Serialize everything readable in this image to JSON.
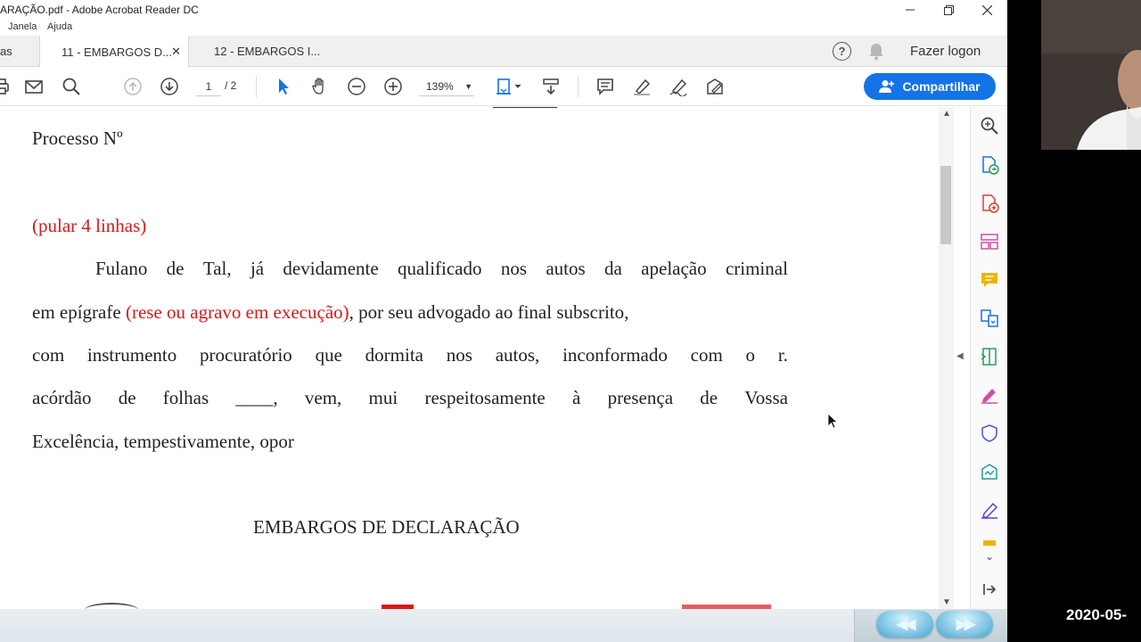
{
  "window": {
    "title": "ARAÇÃO.pdf - Adobe Acrobat Reader DC"
  },
  "menu": {
    "items": [
      "Janela",
      "Ajuda"
    ]
  },
  "tabs": {
    "home_partial": "as",
    "items": [
      {
        "label": "11 - EMBARGOS D...",
        "active": true
      },
      {
        "label": "12 - EMBARGOS I...",
        "active": false
      }
    ],
    "login_label": "Fazer logon"
  },
  "toolbar": {
    "page_current": "1",
    "page_total": "/ 2",
    "zoom": "139%",
    "share_label": "Compartilhar"
  },
  "document": {
    "line_processo": "Processo Nº",
    "line_pular": "(pular 4 linhas)",
    "para1": {
      "line1_words": [
        "Fulano",
        "de",
        "Tal,",
        "já",
        "devidamente",
        "qualificado",
        "nos",
        "autos",
        "da",
        "apelação",
        "criminal"
      ],
      "line2_prefix": "em epígrafe ",
      "line2_red": "(rese ou agravo em execução)",
      "line2_suffix": ", por seu advogado ao final subscrito,",
      "line3_words": [
        "com",
        "instrumento",
        "procuratório",
        "que",
        "dormita",
        "nos",
        "autos,",
        "inconformado",
        "com",
        "o",
        "r."
      ],
      "line4_words": [
        "acórdão",
        "de",
        "folhas",
        "____,",
        "vem,",
        "mui",
        "respeitosamente",
        "à",
        "presença",
        "de",
        "Vossa"
      ],
      "line5": "Excelência, tempestivamente, opor"
    },
    "heading": "EMBARGOS DE DECLARAÇÃO"
  },
  "overlay": {
    "timestamp": "2020-05-"
  },
  "colors": {
    "accent": "#1473e6",
    "red_text": "#d71a1a"
  }
}
